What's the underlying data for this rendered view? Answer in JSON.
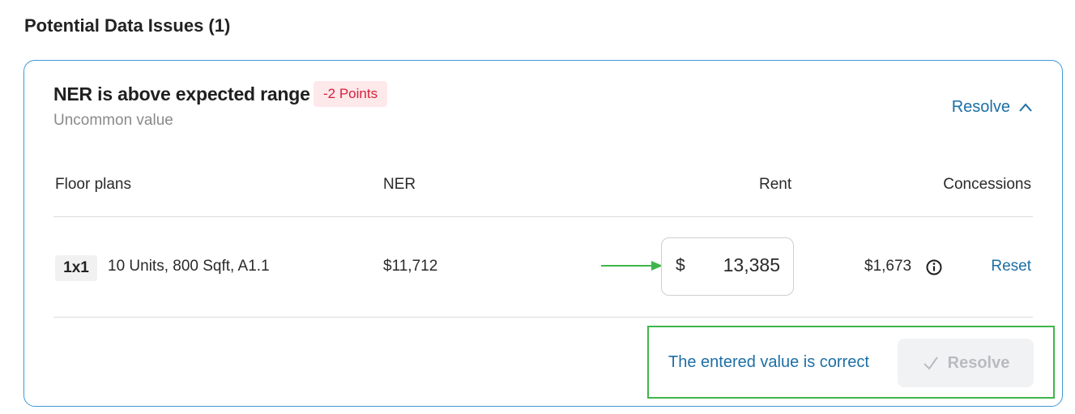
{
  "section": {
    "title": "Potential Data Issues (1)"
  },
  "issue": {
    "title": "NER is above expected range",
    "badge": "-2 Points",
    "subtitle": "Uncommon value",
    "resolve_toggle_label": "Resolve"
  },
  "table": {
    "headers": {
      "floor_plans": "Floor plans",
      "ner": "NER",
      "rent": "Rent",
      "concessions": "Concessions"
    },
    "row": {
      "unit_type": "1x1",
      "description": "10 Units, 800 Sqft, A1.1",
      "ner": "$11,712",
      "rent_currency": "$",
      "rent_value": "13,385",
      "concessions": "$1,673",
      "reset_label": "Reset"
    }
  },
  "confirm": {
    "message": "The entered value is correct",
    "resolve_button_label": "Resolve"
  },
  "colors": {
    "card_border": "#3d9ad6",
    "link": "#1d6fa5",
    "badge_text": "#d6203a",
    "badge_bg": "#fde8ea",
    "highlight_green": "#3fb64a"
  },
  "icons": [
    "chevron-up-icon",
    "arrow-right-icon",
    "info-icon",
    "check-icon"
  ]
}
